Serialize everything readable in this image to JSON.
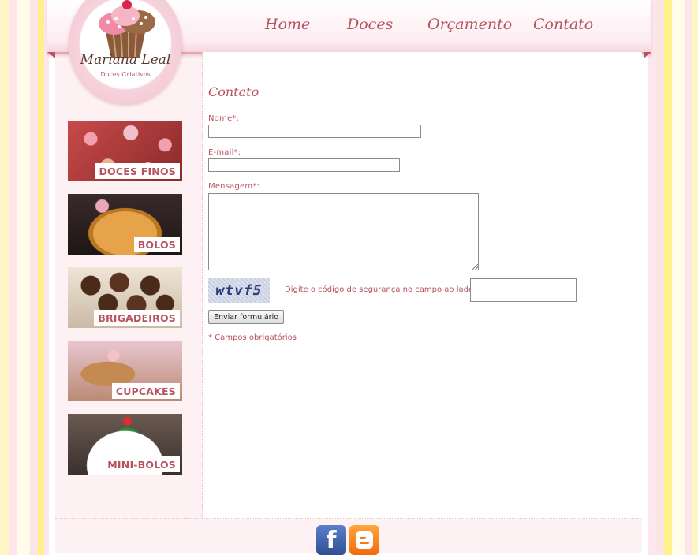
{
  "nav": {
    "items": [
      "Home",
      "Doces",
      "Orçamento",
      "Contato"
    ]
  },
  "logo": {
    "name": "Mariana Leal",
    "tagline": "Doces Criativos"
  },
  "sidebar": {
    "items": [
      {
        "label": "DOCES FINOS"
      },
      {
        "label": "BOLOS"
      },
      {
        "label": "BRIGADEIROS"
      },
      {
        "label": "CUPCAKES"
      },
      {
        "label": "MINI-BOLOS"
      }
    ]
  },
  "form": {
    "title": "Contato",
    "name_label": "Nome*:",
    "name_value": "",
    "email_label": "E-mail*:",
    "email_value": "",
    "message_label": "Mensagem*:",
    "message_value": "",
    "captcha_text": "wtvf5",
    "captcha_hint": "Digite o código de segurança no campo ao lado",
    "captcha_value": "",
    "submit_label": "Enviar formulário",
    "required_note": "* Campos obrigatórios"
  },
  "social": {
    "facebook_glyph": "f"
  },
  "colors": {
    "accent": "#b8525f",
    "pink_bg": "#fdf1f4"
  }
}
